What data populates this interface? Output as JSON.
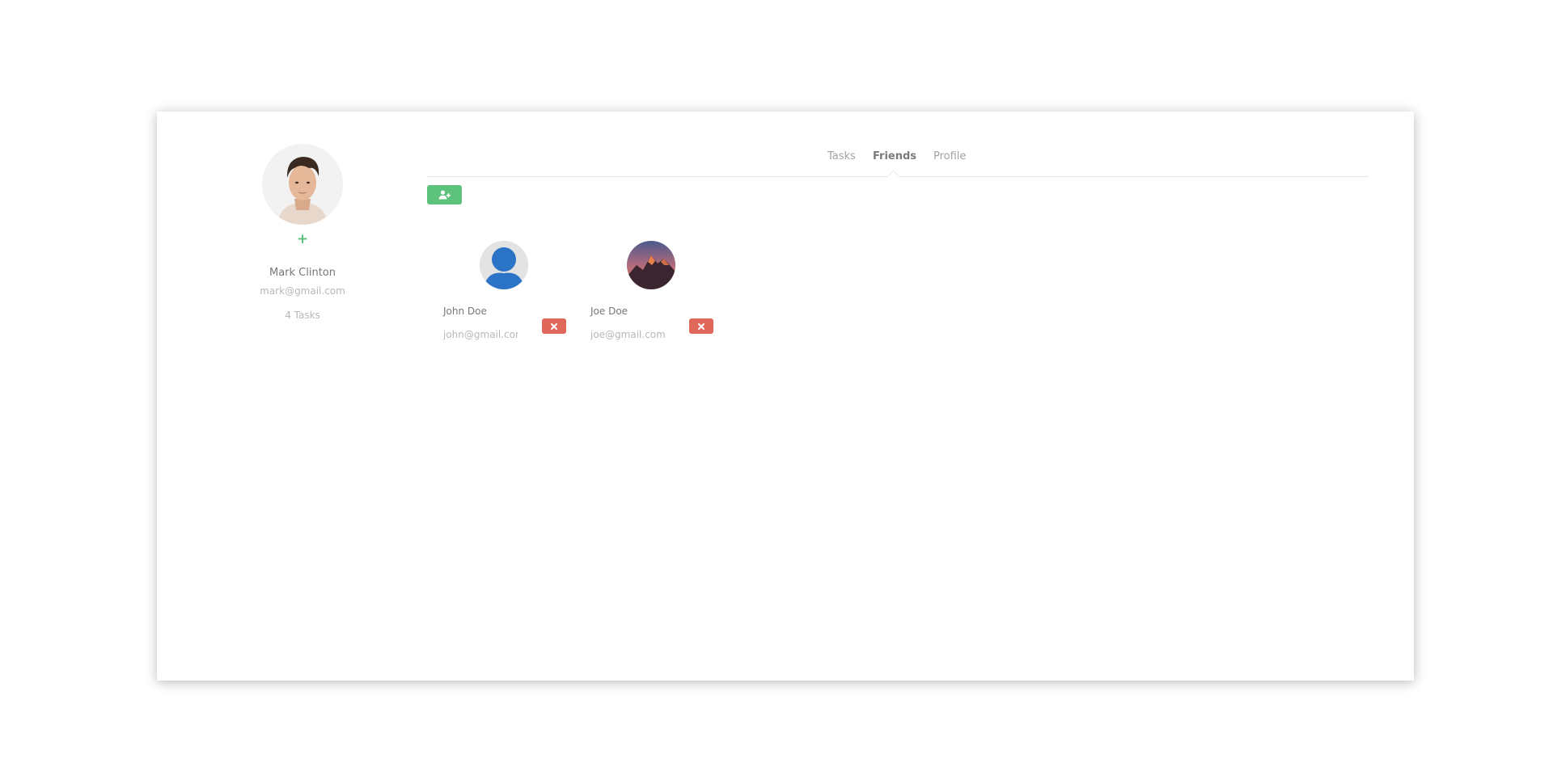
{
  "profile": {
    "avatar_icon": "user-portrait-photo",
    "add_photo_label": "+",
    "name": "Mark Clinton",
    "email": "mark@gmail.com",
    "tasks_label": "4 Tasks"
  },
  "tabs": [
    {
      "label": "Tasks",
      "active": false
    },
    {
      "label": "Friends",
      "active": true
    },
    {
      "label": "Profile",
      "active": false
    }
  ],
  "toolbar": {
    "add_friend_icon": "user-plus-icon"
  },
  "friends": [
    {
      "name": "John Doe",
      "email": "john@gmail.com",
      "avatar": "default-user-avatar"
    },
    {
      "name": "Joe Doe",
      "email": "joe@gmail.com",
      "avatar": "mountain-photo-avatar"
    }
  ],
  "colors": {
    "accent_green": "#5cc27c",
    "danger_red": "#e0685b",
    "text_dark": "#777777",
    "text_light": "#b8b8b8"
  }
}
